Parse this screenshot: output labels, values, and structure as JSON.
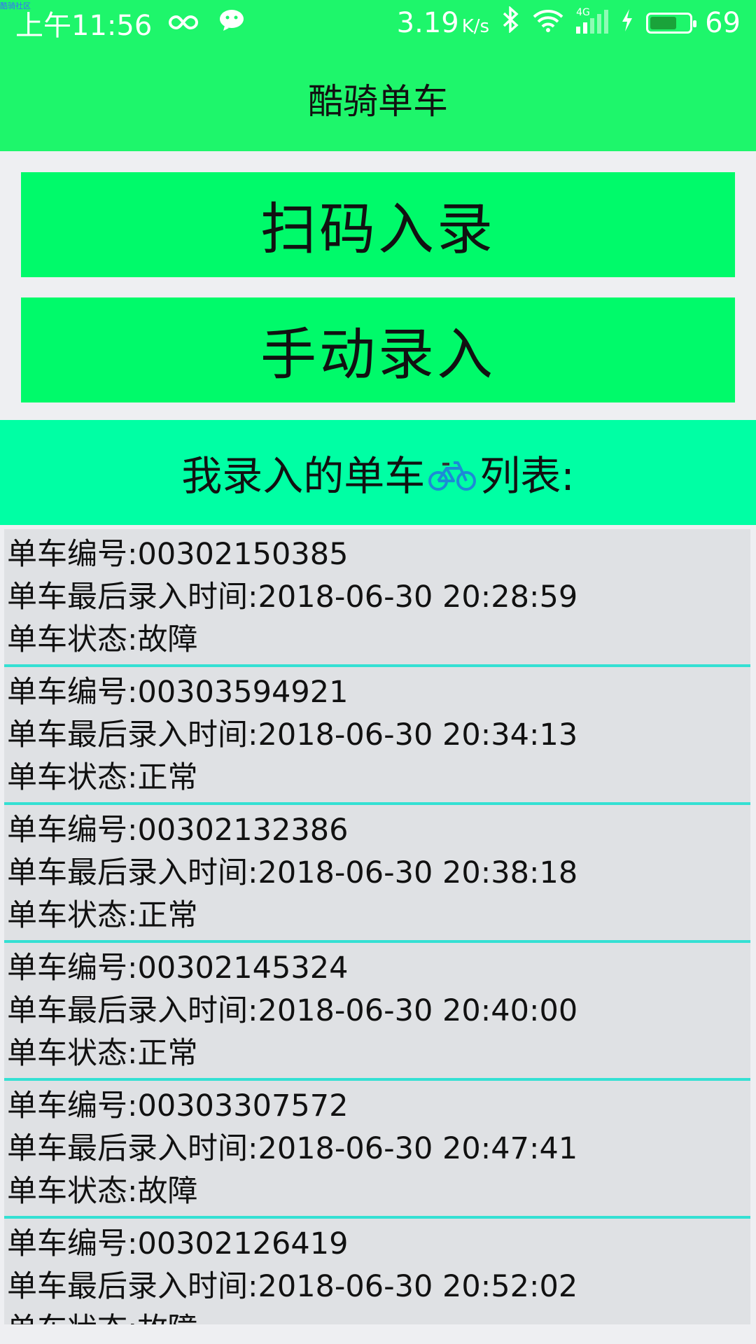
{
  "status_bar": {
    "tiny_label": "酷骑社区",
    "time": "上午11:56",
    "net_speed_value": "3.19",
    "net_speed_unit": "K/s",
    "signal_label": "4G",
    "battery_percent": "69"
  },
  "app": {
    "title": "酷骑单车"
  },
  "actions": {
    "scan_label": "扫码入录",
    "manual_label": "手动录入"
  },
  "list_header": {
    "prefix": "我录入的单车",
    "suffix": "列表:",
    "icon": "bicycle-icon"
  },
  "bikes": [
    {
      "id_line": "单车编号:00302150385",
      "time_line": "单车最后录入时间:2018-06-30 20:28:59",
      "status_line": "单车状态:故障"
    },
    {
      "id_line": "单车编号:00303594921",
      "time_line": "单车最后录入时间:2018-06-30 20:34:13",
      "status_line": "单车状态:正常"
    },
    {
      "id_line": "单车编号:00302132386",
      "time_line": "单车最后录入时间:2018-06-30 20:38:18",
      "status_line": "单车状态:正常"
    },
    {
      "id_line": "单车编号:00302145324",
      "time_line": "单车最后录入时间:2018-06-30 20:40:00",
      "status_line": "单车状态:正常"
    },
    {
      "id_line": "单车编号:00303307572",
      "time_line": "单车最后录入时间:2018-06-30 20:47:41",
      "status_line": "单车状态:故障"
    },
    {
      "id_line": "单车编号:00302126419",
      "time_line": "单车最后录入时间:2018-06-30 20:52:02",
      "status_line": "单车状态:故障"
    }
  ],
  "colors": {
    "primary_green": "#1ef66b",
    "button_green": "#00fa6a",
    "header_mint": "#00ffa4",
    "list_bg": "#dfe1e4",
    "divider_cyan": "#34e0d3"
  }
}
